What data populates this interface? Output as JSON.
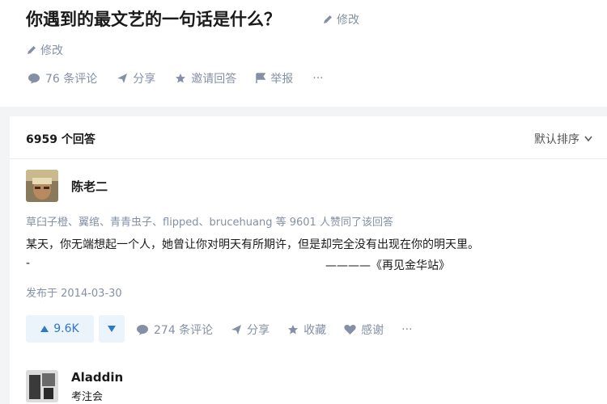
{
  "question": {
    "title": "你遇到的最文艺的一句话是什么？",
    "edit_inline_label": "修改",
    "edit_label": "修改",
    "actions": {
      "comments": "76 条评论",
      "share": "分享",
      "invite": "邀请回答",
      "report": "举报",
      "more": "···"
    }
  },
  "answers": {
    "count_label": "6959 个回答",
    "sort_label": "默认排序",
    "first": {
      "author": "陈老二",
      "voters": "草臼子橙、翼绾、青青虫子、flipped、brucehuang 等 9601 人赞同了该回答",
      "content": "某天，你无端想起一个人，她曾让你对明天有所期许，但是却完全没有出现在你的明天里。",
      "dash": "-",
      "source": "————《再见金华站》",
      "published": "发布于 2014-03-30",
      "vote_count": "9.6K",
      "actions": {
        "comments": "274 条评论",
        "share": "分享",
        "collect": "收藏",
        "thanks": "感谢",
        "more": "···"
      }
    },
    "second": {
      "author": "Aladdin",
      "headline": "考注会"
    }
  },
  "colors": {
    "accent": "#2d78c8",
    "muted": "#8590a6",
    "vote_bg": "#ebf3fb"
  }
}
